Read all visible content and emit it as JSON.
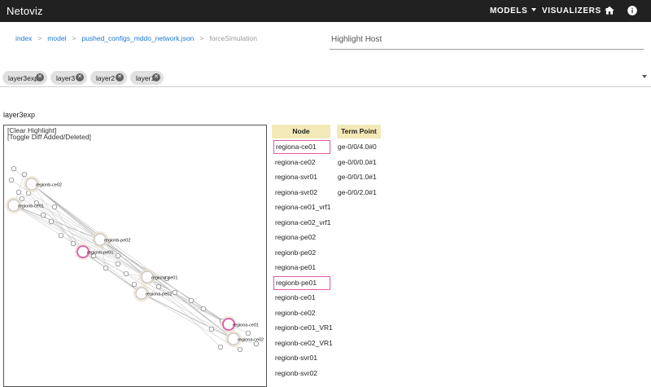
{
  "app": {
    "title": "Netoviz"
  },
  "nav": {
    "models_label": "MODELS",
    "visualizers_label": "VISUALIZERS",
    "home_icon": "home-icon",
    "info_icon": "info-icon"
  },
  "breadcrumb": {
    "items": [
      "index",
      "model",
      "pushed_configs_mddo_network.json"
    ],
    "current": "forceSimulation",
    "separator": ">"
  },
  "highlight_host": {
    "placeholder": "Highlight Host",
    "value": ""
  },
  "layers": {
    "chips": [
      {
        "label": "layer3exp"
      },
      {
        "label": "layer3"
      },
      {
        "label": "layer2"
      },
      {
        "label": "layer1"
      }
    ]
  },
  "graph": {
    "heading": "layer3exp",
    "clear_highlight": "[Clear Highlight]",
    "toggle_diff": "[Toggle Diff Added/Deleted]",
    "node_labels": [
      "regionb-ce02",
      "regionb-ce01",
      "regionb-pe02",
      "regionb-pe01",
      "regiona-pe01",
      "regiona-pe02",
      "regiona-ce01",
      "regiona-ce02"
    ]
  },
  "node_table": {
    "header": "Node",
    "rows": [
      {
        "name": "regiona-ce01",
        "highlighted": true
      },
      {
        "name": "regiona-ce02",
        "highlighted": false
      },
      {
        "name": "regiona-svr01",
        "highlighted": false
      },
      {
        "name": "regiona-svr02",
        "highlighted": false
      },
      {
        "name": "regiona-ce01_vrf1",
        "highlighted": false
      },
      {
        "name": "regiona-ce02_vrf1",
        "highlighted": false
      },
      {
        "name": "regiona-pe02",
        "highlighted": false
      },
      {
        "name": "regionb-pe02",
        "highlighted": false
      },
      {
        "name": "regiona-pe01",
        "highlighted": false
      },
      {
        "name": "regionb-pe01",
        "highlighted": true
      },
      {
        "name": "regionb-ce01",
        "highlighted": false
      },
      {
        "name": "regionb-ce02",
        "highlighted": false
      },
      {
        "name": "regionb-ce01_VR1",
        "highlighted": false
      },
      {
        "name": "regionb-ce02_VR1",
        "highlighted": false
      },
      {
        "name": "regionb-svr01",
        "highlighted": false
      },
      {
        "name": "regionb-svr02",
        "highlighted": false
      }
    ]
  },
  "tp_table": {
    "header": "Term Point",
    "rows": [
      "ge-0/0/4.0#0",
      "ge-0/0/0.0#1",
      "ge-0/0/1.0#1",
      "ge-0/0/2.0#1"
    ]
  },
  "colors": {
    "appbar": "#212121",
    "link": "#1976d2",
    "table_header": "#f3e9b7",
    "highlight": "#e05aa8",
    "node_halo": "#e9e0cf"
  }
}
